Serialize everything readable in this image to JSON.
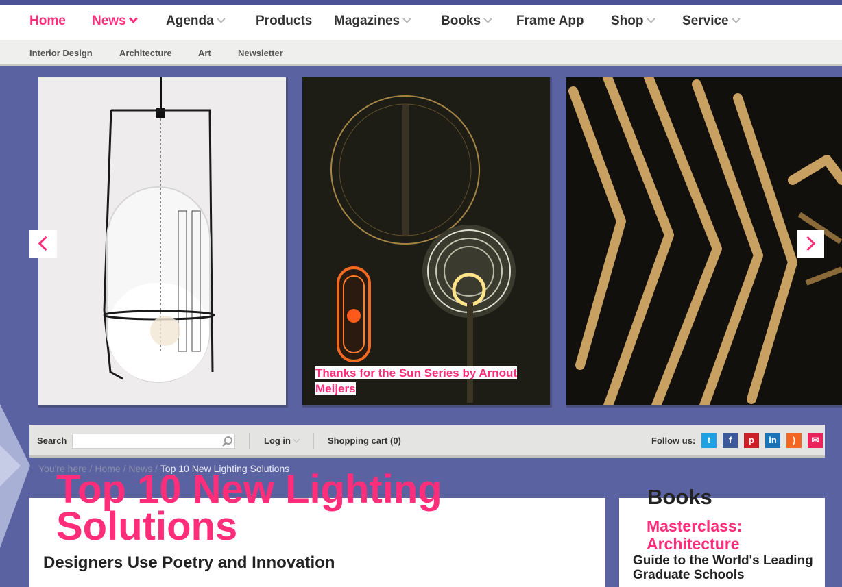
{
  "main_nav": {
    "items": [
      {
        "label": "Home",
        "active": true,
        "has_dropdown": false
      },
      {
        "label": "News",
        "active": true,
        "has_dropdown": true
      },
      {
        "label": "Agenda",
        "active": false,
        "has_dropdown": true
      },
      {
        "label": "Products",
        "active": false,
        "has_dropdown": false
      },
      {
        "label": "Magazines",
        "active": false,
        "has_dropdown": true
      },
      {
        "label": "Books",
        "active": false,
        "has_dropdown": true
      },
      {
        "label": "Frame App",
        "active": false,
        "has_dropdown": false
      },
      {
        "label": "Shop",
        "active": false,
        "has_dropdown": true
      },
      {
        "label": "Service",
        "active": false,
        "has_dropdown": true
      }
    ]
  },
  "sub_nav": {
    "items": [
      "Interior Design",
      "Architecture",
      "Art",
      "Newsletter"
    ]
  },
  "carousel": {
    "caption": "Thanks for the Sun Series by Arnout Meijers",
    "prev_icon": "chevron-left-icon",
    "next_icon": "chevron-right-icon"
  },
  "toolbar": {
    "search_label": "Search",
    "search_value": "",
    "login_label": "Log in",
    "cart_label": "Shopping cart (0)",
    "follow_label": "Follow us:",
    "social": [
      {
        "name": "twitter-icon",
        "glyph": "t",
        "color": "#1da1e2"
      },
      {
        "name": "facebook-icon",
        "glyph": "f",
        "color": "#3b5998"
      },
      {
        "name": "pinterest-icon",
        "glyph": "p",
        "color": "#cb2027"
      },
      {
        "name": "linkedin-icon",
        "glyph": "in",
        "color": "#1a73b5"
      },
      {
        "name": "rss-icon",
        "glyph": ")",
        "color": "#f26522"
      },
      {
        "name": "newsletter-icon",
        "glyph": "✉",
        "color": "#e9245c"
      }
    ]
  },
  "breadcrumb": {
    "prefix": "You're here",
    "items": [
      "Home",
      "News"
    ],
    "current": "Top 10 New Lighting Solutions",
    "separator": " / "
  },
  "article": {
    "title": "Top 10 New Lighting Solutions",
    "subtitle": "Designers Use Poetry and Innovation"
  },
  "books": {
    "title": "Books",
    "book_name": "Masterclass: Architecture",
    "book_subtitle": "Guide to the World's Leading Graduate Schools"
  },
  "colors": {
    "accent": "#ff2d7a",
    "background": "#5a62a1"
  }
}
